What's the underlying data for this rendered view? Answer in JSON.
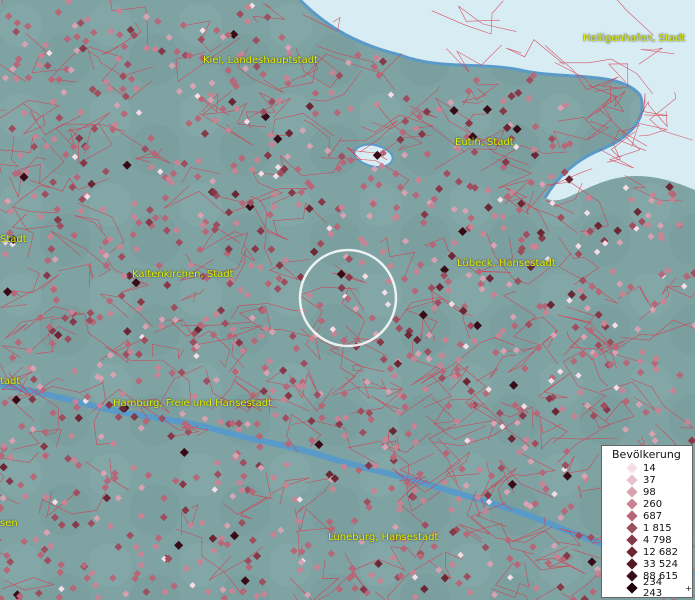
{
  "labels": {
    "kiel": "Kiel, Landeshauptstadt",
    "heiligenhafen": "Heiligenhafen, Stadt",
    "eutin": "Eutin, Stadt",
    "luebeck": "Lübeck, Hansestadt",
    "kaltenkirchen": "Kaltenkirchen, Stadt",
    "hamburg": "Hamburg, Freie und Hansestadt",
    "lueneburg": "Lüneburg, Hansestadt",
    "left_stadt": "Stadt",
    "left_tadt": "tadt",
    "left_sen": "sen"
  },
  "legend": {
    "title": "Bevölkerung",
    "items": [
      {
        "label": "14",
        "color": "#f6dde6"
      },
      {
        "label": "37",
        "color": "#e9c0cc"
      },
      {
        "label": "98",
        "color": "#d9a2b1"
      },
      {
        "label": "260",
        "color": "#c98494"
      },
      {
        "label": "687",
        "color": "#b66778"
      },
      {
        "label": "1 815",
        "color": "#9e4f5f"
      },
      {
        "label": "4 798",
        "color": "#863a49"
      },
      {
        "label": "12 682",
        "color": "#6c2735"
      },
      {
        "label": "33 524",
        "color": "#521724"
      },
      {
        "label": "88 615",
        "color": "#380c16"
      },
      {
        "label": "234 243",
        "color": "#1e040a"
      }
    ],
    "plus": "+"
  },
  "colors": {
    "land": "#7fa3a3",
    "water": "#d8ecf4",
    "river": "#5a9ac8",
    "borders": "#d83a4a",
    "label": "#e8f000"
  }
}
